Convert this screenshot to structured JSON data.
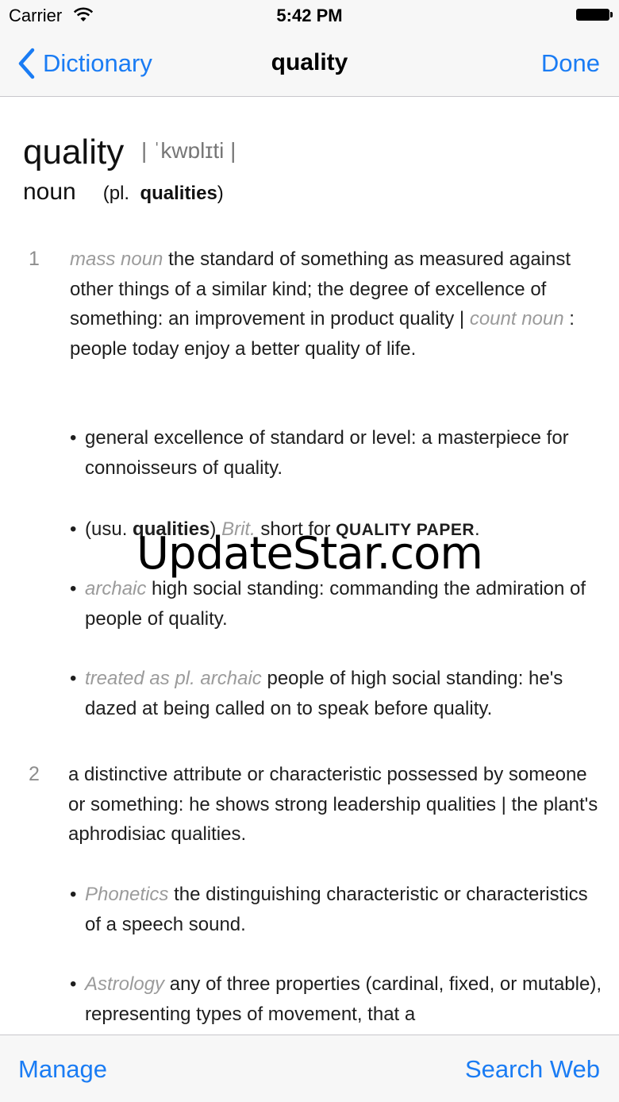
{
  "status_bar": {
    "carrier": "Carrier",
    "time": "5:42 PM"
  },
  "nav": {
    "back_label": "Dictionary",
    "title": "quality",
    "done_label": "Done",
    "accent_color": "#1a7cf4"
  },
  "entry": {
    "headword": "quality",
    "pronunciation": "| ˈkwɒlɪti |",
    "part_of_speech": "noun",
    "plural_prefix": "(pl.",
    "plural_form": "qualities",
    "plural_suffix": ")",
    "senses": [
      {
        "number": "1",
        "label": "mass noun",
        "text_a": " the standard of something as measured against other things of a similar kind; the degree of excellence of something: an improvement in product quality | ",
        "label2": "count noun",
        "text_b": " : people today enjoy a better quality of life.",
        "subsenses": [
          {
            "bullet": "•",
            "text": " general excellence of standard or level: a masterpiece for connoisseurs of quality."
          },
          {
            "bullet": "•",
            "prefix": " (usu. ",
            "bold": "qualities",
            "after_bold": ") ",
            "label": "Brit.",
            "text": "  short for ",
            "smallcaps": "QUALITY PAPER",
            "end": "."
          },
          {
            "bullet": "•",
            "label": " archaic",
            "text": "  high social standing: commanding the admiration of people of quality."
          },
          {
            "bullet": "•",
            "label": " treated as pl.  archaic",
            "text": "  people of high social standing: he's dazed at being called on to speak before quality."
          }
        ]
      },
      {
        "number": "2",
        "text": "a distinctive attribute or characteristic possessed by someone or something: he shows strong leadership qualities | the plant's aphrodisiac qualities.",
        "subsenses": [
          {
            "bullet": "•",
            "label": " Phonetics",
            "text": "  the distinguishing characteristic or characteristics of a speech sound."
          },
          {
            "bullet": "•",
            "label": " Astrology",
            "text": "  any of three properties (cardinal, fixed, or mutable), representing types of movement, that a"
          }
        ]
      }
    ]
  },
  "watermark": "UpdateStar.com",
  "toolbar": {
    "manage_label": "Manage",
    "search_web_label": "Search Web"
  }
}
